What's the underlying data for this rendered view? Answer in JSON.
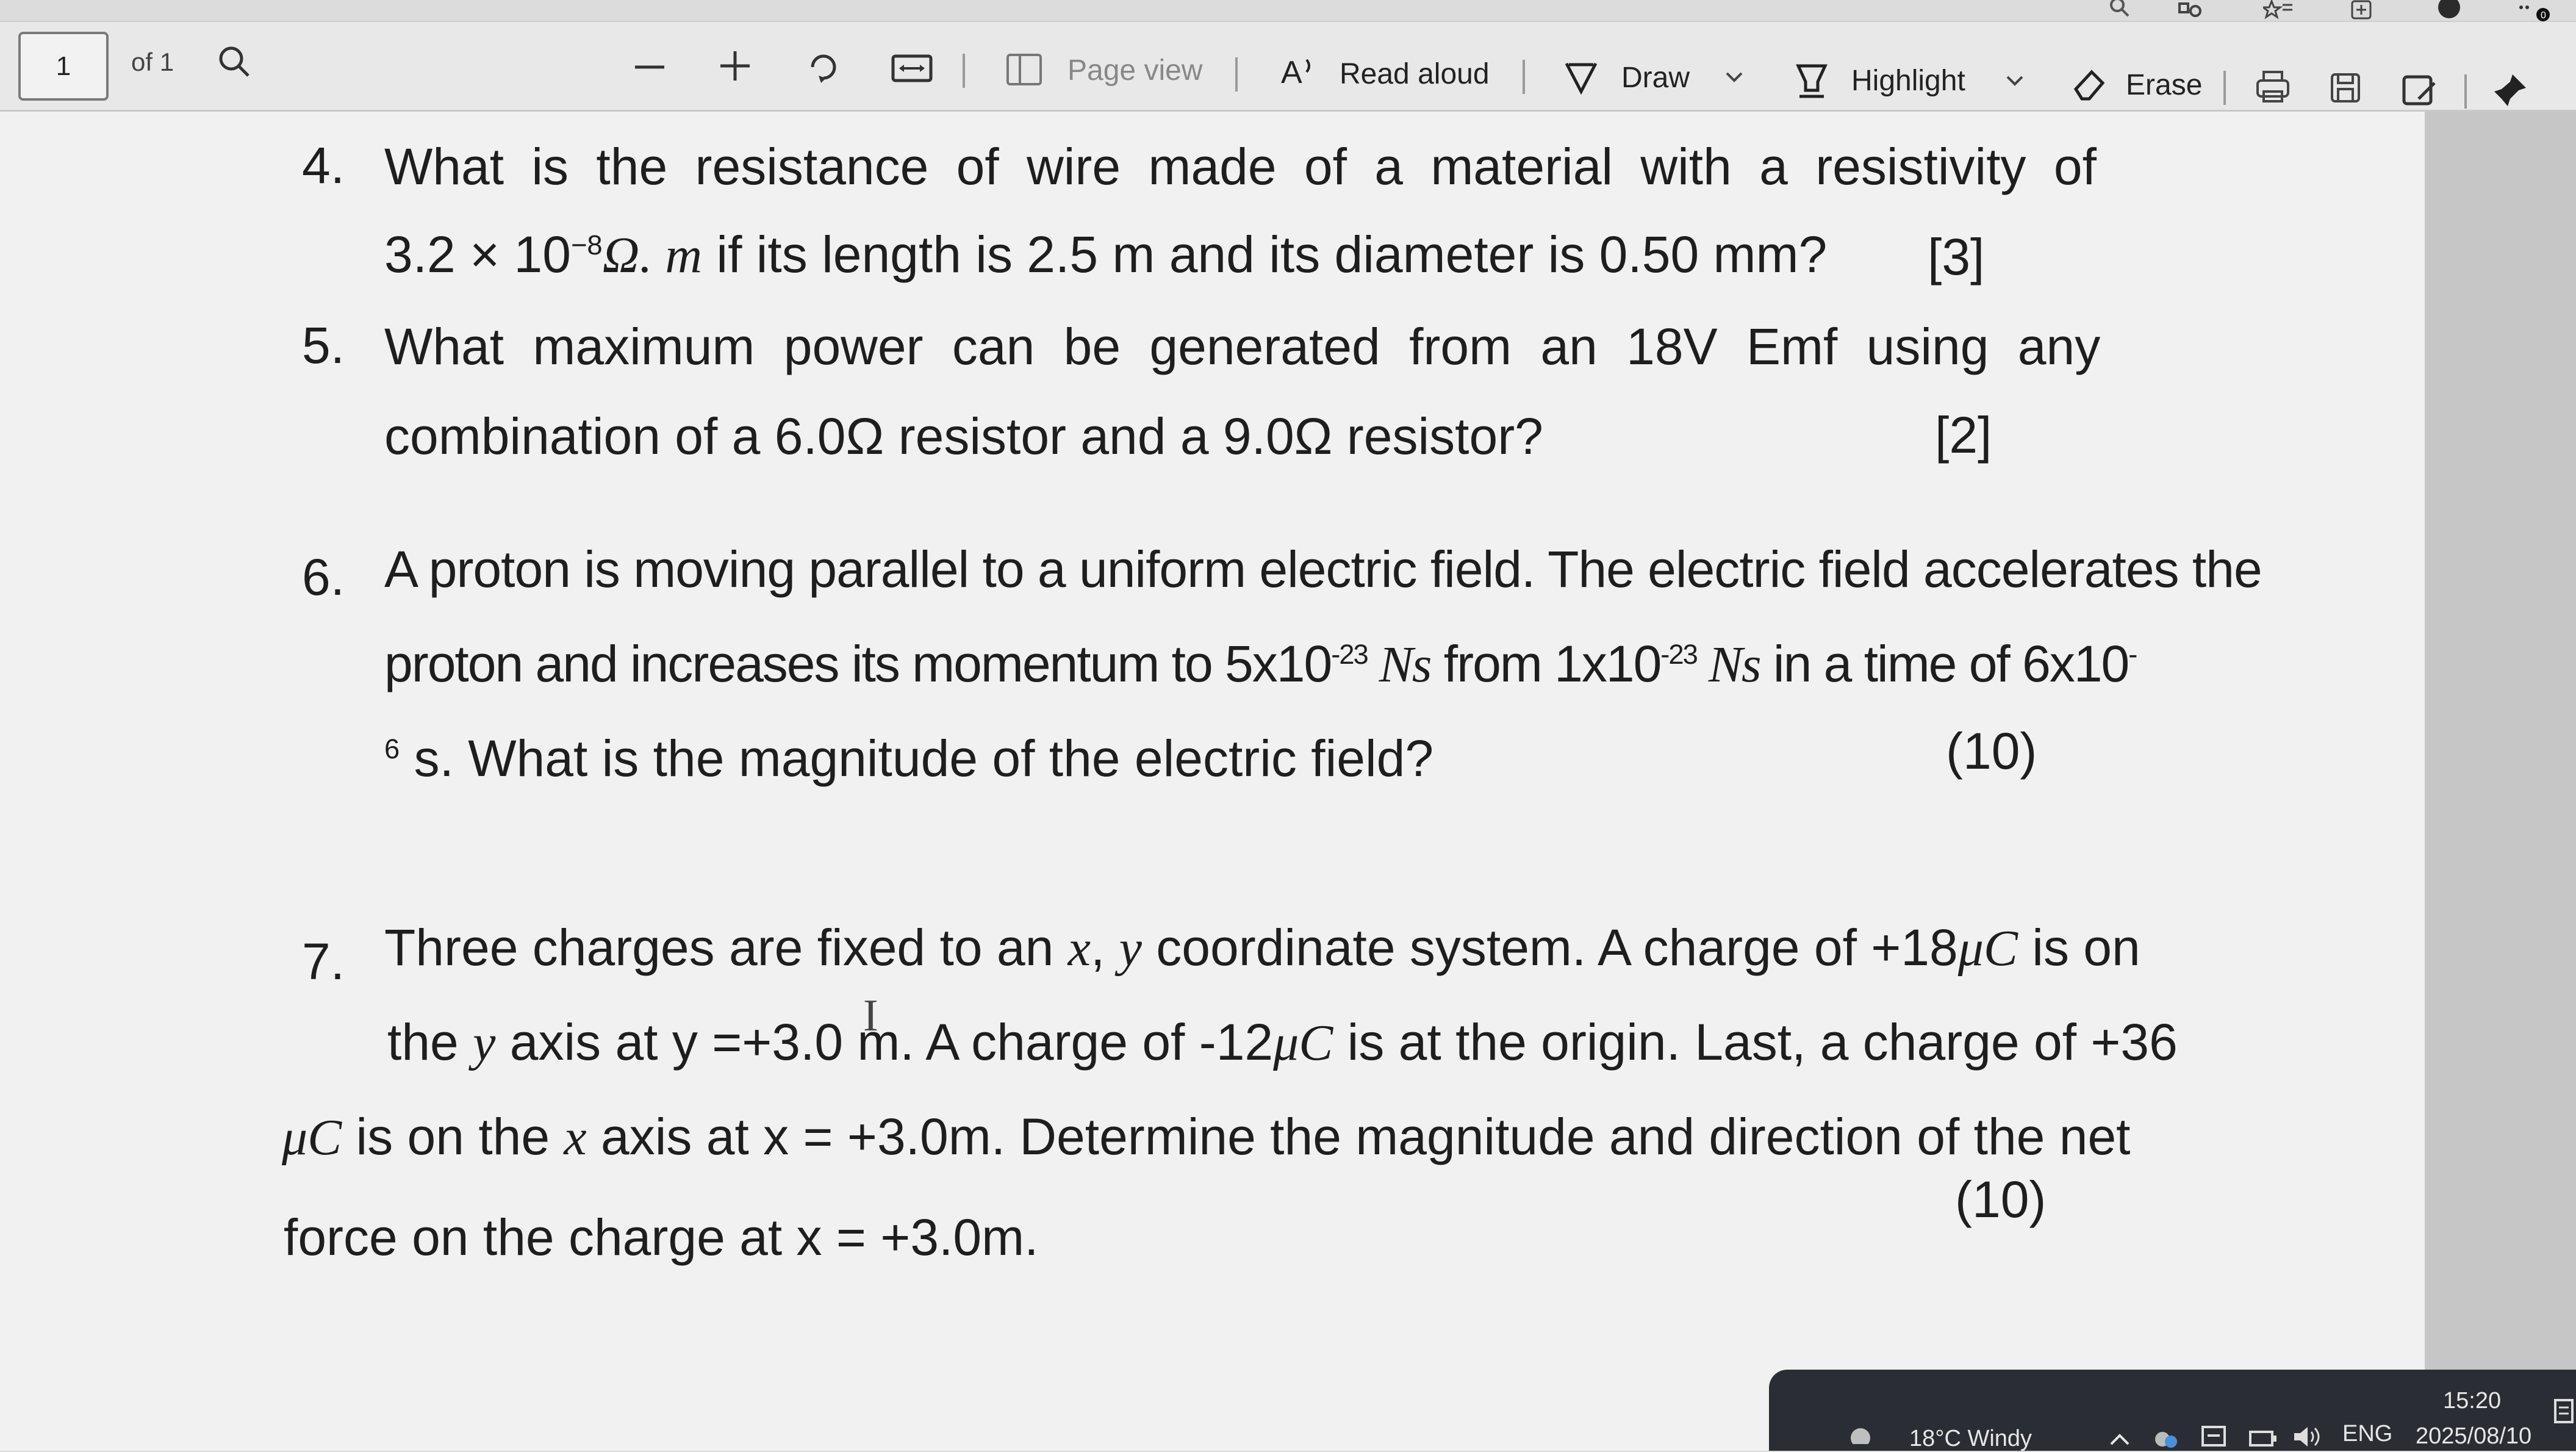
{
  "toolbar": {
    "page_number": "1",
    "page_count_label": "of 1",
    "page_view_label": "Page view",
    "read_aloud_label": "Read aloud",
    "draw_label": "Draw",
    "highlight_label": "Highlight",
    "erase_label": "Erase"
  },
  "questions": {
    "q4": {
      "number": "4.",
      "line1": "What is the resistance of wire made of a material with a resistivity of",
      "line2_coef": "3.2 × 10",
      "line2_exp": "−8",
      "line2_unit": "Ω. m",
      "line2_rest": " if its length is 2.5 m and its diameter is 0.50 mm?",
      "marks": "[3]"
    },
    "q5": {
      "number": "5.",
      "line1": "What maximum power can be generated from an 18V Emf using any",
      "line2": "combination of a 6.0Ω resistor and a 9.0Ω resistor?",
      "marks": "[2]"
    },
    "q6": {
      "number": "6.",
      "line1": "A proton is moving parallel to a uniform electric field. The electric field accelerates the",
      "line2_a": "proton and increases its momentum to 5x10",
      "line2_exp1": "-23",
      "line2_unit1": " Ns",
      "line2_b": " from 1x10",
      "line2_exp2": "-23",
      "line2_unit2": " Ns",
      "line2_c": " in a time of 6x10",
      "line2_exp3": "-",
      "line3_exp": "6",
      "line3": " s. What is the magnitude of the electric field?",
      "marks": "(10)"
    },
    "q7": {
      "number": "7.",
      "line1_a": "Three charges are fixed to an ",
      "line1_x": "x",
      "line1_comma": ", ",
      "line1_y": "y",
      "line1_b": " coordinate system. A charge of +18",
      "line1_unit": "μC",
      "line1_c": " is on",
      "line2_a": "the ",
      "line2_y": "y",
      "line2_b": " axis at y =+3.0 m. A charge of -12",
      "line2_unit": "μC",
      "line2_c": " is at the origin. Last, a charge of +36",
      "line3_unit": "μC",
      "line3_a": " is on the ",
      "line3_x": "x",
      "line3_b": " axis at x = +3.0m. Determine the magnitude and direction of the net",
      "line4": "force on the charge at x = +3.0m.",
      "marks": "(10)"
    }
  },
  "taskbar": {
    "weather": "18°C  Windy",
    "language": "ENG",
    "time": "15:20",
    "date": "2025/08/10"
  }
}
